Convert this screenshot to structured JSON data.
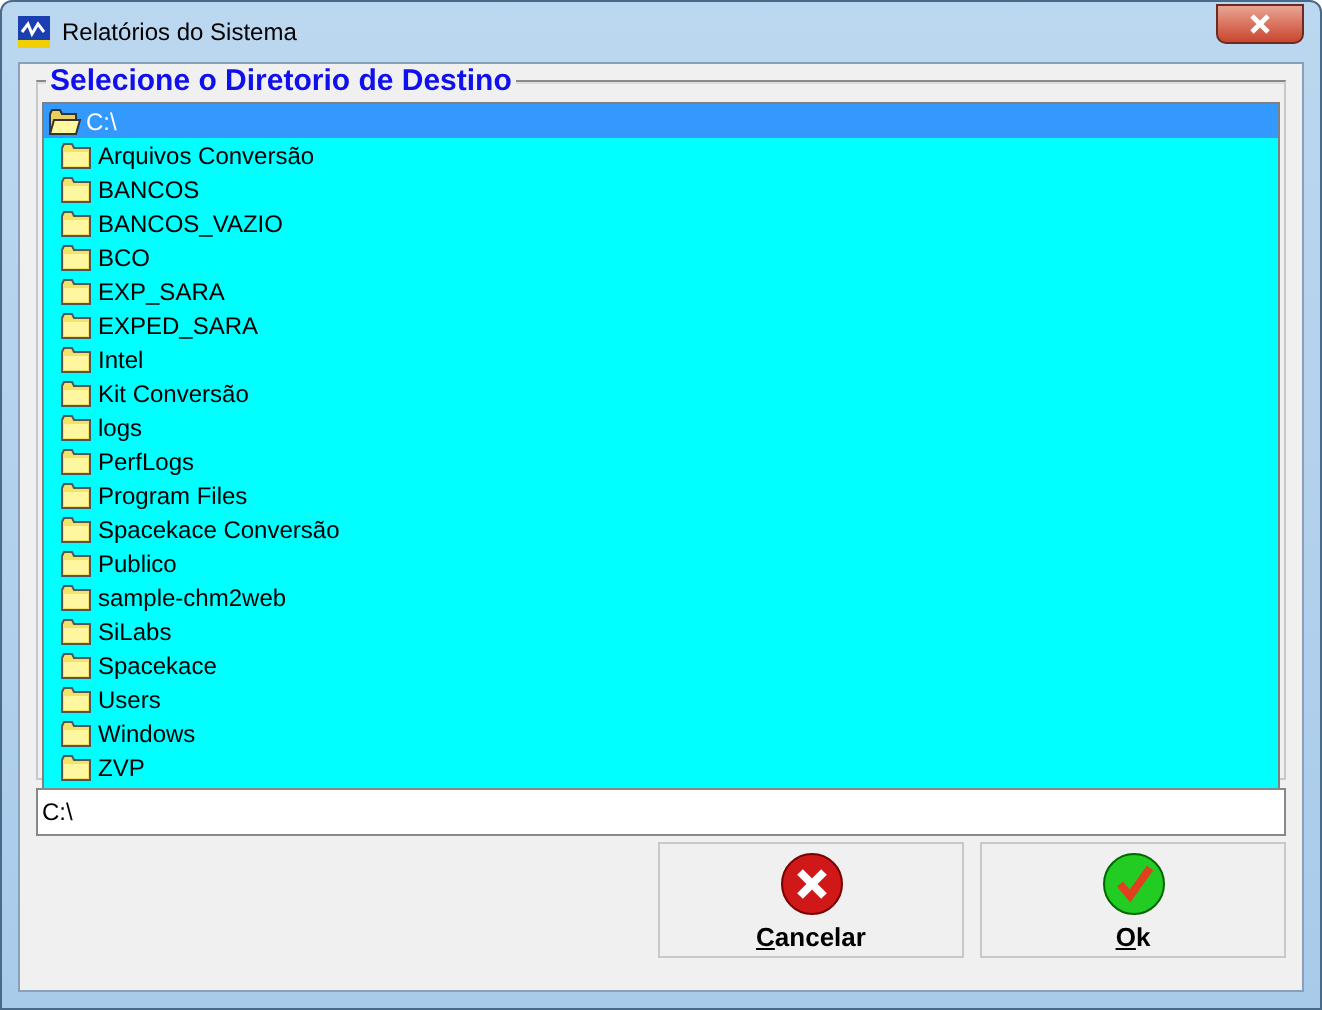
{
  "window": {
    "title": "Relatórios do Sistema"
  },
  "group": {
    "title": "Selecione o Diretorio de Destino"
  },
  "tree": [
    {
      "label": "C:\\",
      "selected": true,
      "expanded": true,
      "children": [
        {
          "label": "Arquivos Conversão",
          "selected": false
        },
        {
          "label": "BANCOS",
          "selected": false
        },
        {
          "label": "BANCOS_VAZIO",
          "selected": false
        },
        {
          "label": "BCO",
          "selected": false
        },
        {
          "label": "EXP_SARA",
          "selected": false
        },
        {
          "label": "EXPED_SARA",
          "selected": false
        },
        {
          "label": "Intel",
          "selected": false
        },
        {
          "label": "Kit Conversão",
          "selected": false
        },
        {
          "label": "logs",
          "selected": false
        },
        {
          "label": "PerfLogs",
          "selected": false
        },
        {
          "label": "Program Files",
          "selected": false
        },
        {
          "label": "Spacekace Conversão",
          "selected": false
        },
        {
          "label": "Publico",
          "selected": false
        },
        {
          "label": "sample-chm2web",
          "selected": false
        },
        {
          "label": "SiLabs",
          "selected": false
        },
        {
          "label": "Spacekace",
          "selected": false
        },
        {
          "label": "Users",
          "selected": false
        },
        {
          "label": "Windows",
          "selected": false
        },
        {
          "label": "ZVP",
          "selected": false
        }
      ]
    }
  ],
  "path": {
    "value": "C:\\"
  },
  "buttons": [
    {
      "kind": "cancel",
      "accel": "C",
      "rest": "ancelar"
    },
    {
      "kind": "ok",
      "accel": "O",
      "rest": "k"
    }
  ]
}
